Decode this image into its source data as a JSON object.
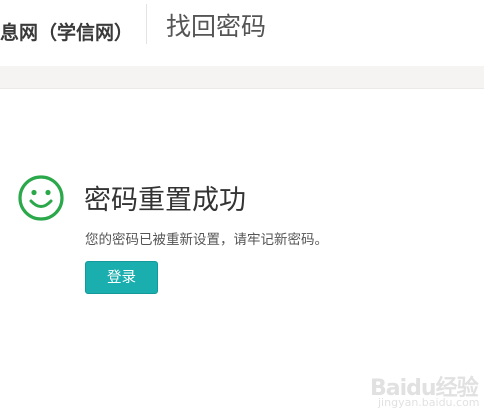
{
  "header": {
    "site_name": "息网（学信网）",
    "page_title": "找回密码"
  },
  "result": {
    "icon": "smile-icon",
    "title": "密码重置成功",
    "description": "您的密码已被重新设置，请牢记新密码。",
    "login_label": "登录"
  },
  "watermark": {
    "brand": "Baidu经验",
    "sub": "jingyan.baidu.com"
  },
  "colors": {
    "accent": "#1aaeae",
    "success": "#2aa84a",
    "band": "#f5f4f2"
  }
}
